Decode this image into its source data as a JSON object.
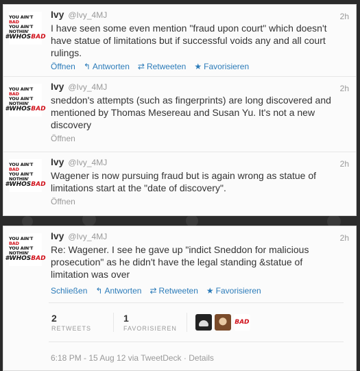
{
  "avatar": {
    "line1a": "YOU AIN'T ",
    "line1b": "BAD",
    "line2": "YOU AIN'T NOTHIN'",
    "line3a": "#WHOS",
    "line3b": "BAD"
  },
  "tweets": [
    {
      "name": "Ivy",
      "handle": "@Ivy_4MJ",
      "time": "2h",
      "text": "I have seen some even mention \"fraud upon court\" which doesn't have statue of limitations but if successful voids any and all court rulings.",
      "actions": {
        "open": "Öffnen",
        "reply": "Antworten",
        "retweet": "Retweeten",
        "favorite": "Favorisieren"
      }
    },
    {
      "name": "Ivy",
      "handle": "@Ivy_4MJ",
      "time": "2h",
      "text": "sneddon's attempts (such as fingerprints) are long discovered and mentioned by Thomas Mesereau and Susan Yu. It's not a new discovery",
      "actions": {
        "open": "Öffnen"
      }
    },
    {
      "name": "Ivy",
      "handle": "@Ivy_4MJ",
      "time": "2h",
      "text": "Wagener is now pursuing fraud but is again wrong as statue of limitations start at the \"date of discovery\".",
      "actions": {
        "open": "Öffnen"
      }
    }
  ],
  "expanded": {
    "name": "Ivy",
    "handle": "@Ivy_4MJ",
    "time": "2h",
    "text": "Re: Wagener. I see he gave up \"indict Sneddon for malicious prosecution\" as he didn't have the legal standing &statue of limitation was over",
    "actions": {
      "close": "Schließen",
      "reply": "Antworten",
      "retweet": "Retweeten",
      "favorite": "Favorisieren"
    },
    "stats": {
      "retweets": "2",
      "retweets_label": "RETWEETS",
      "favorites": "1",
      "favorites_label": "FAVORISIEREN"
    },
    "faces": [
      "avatar-1",
      "avatar-2",
      "avatar-3"
    ],
    "face3_text": "BAD",
    "footer": {
      "time": "6:18 PM - 15 Aug 12 via TweetDeck",
      "sep": " · ",
      "details": "Details"
    }
  },
  "colors": {
    "link": "#2b7bb9",
    "muted": "#999999",
    "text": "#333333",
    "accent_red": "#d0101a"
  }
}
